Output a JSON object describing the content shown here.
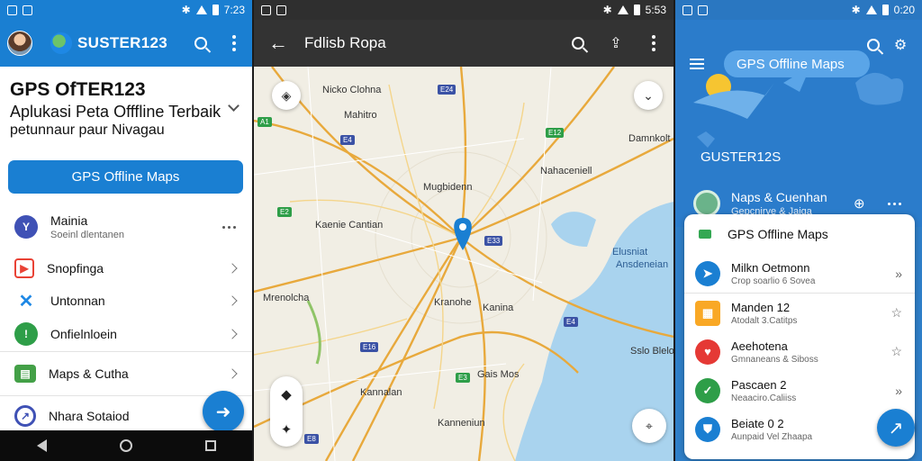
{
  "phone1": {
    "status": {
      "time": "7:23"
    },
    "appbar": {
      "title": "SUSTER123"
    },
    "heading": {
      "title": "GPS OfTER123",
      "subtitle": "Aplukasi Peta Offfline Terbaik",
      "subtitle2": "petunnaur paur Nivagau"
    },
    "primary_button": "GPS Offline Maps",
    "items": [
      {
        "title": "Mainia",
        "subtitle": "Soeinl dlentanen",
        "icon": "pin-icon",
        "color": "#3f51b5"
      },
      {
        "title": "Snopfinga",
        "subtitle": "",
        "icon": "maps-logo-icon",
        "color": "#e94235"
      },
      {
        "title": "Untonnan",
        "subtitle": "",
        "icon": "cross-arrows-icon",
        "color": "#1e88e5"
      },
      {
        "title": "Onfielnloein",
        "subtitle": "",
        "icon": "location-icon",
        "color": "#2e9e48"
      },
      {
        "title": "Maps & Cutha",
        "subtitle": "",
        "icon": "map-card-icon",
        "color": "#43a047"
      },
      {
        "title": "Nhara Sotaiod",
        "subtitle": "",
        "icon": "compass-icon",
        "color": "#3f51b5"
      }
    ],
    "fab_icon": "navigate-icon"
  },
  "phone2": {
    "status": {
      "time": "5:53"
    },
    "appbar": {
      "title": "Fdlisb Ropa"
    },
    "labels": [
      "Nicko Clohna",
      "Mahitro",
      "Damnkolt",
      "Mugbidenn",
      "Kaenie Cantian",
      "Mrenolcha",
      "Kranohe",
      "Kanina",
      "Kannalan",
      "Kanneniun",
      "Gais Mos",
      "Nahaceniell",
      "Sslo Blelo",
      "Elusniat",
      "Ansdeneian"
    ]
  },
  "phone3": {
    "status": {
      "time": "0:20"
    },
    "pill_title": "GPS Offline Maps",
    "hero_title": "GUSTER12S",
    "hero_card": {
      "title": "Naps & Cuenhan",
      "subtitle": "Gepcnirve & Jaiga"
    },
    "sheet_title": "GPS Offline Maps",
    "items": [
      {
        "title": "Milkn Oetmonn",
        "subtitle": "Crop soarlio 6 Sovea",
        "color": "#1a7fd2",
        "trail": "»"
      },
      {
        "title": "Manden 12",
        "subtitle": "Atodalt 3.Catitps",
        "color": "#f9a825",
        "trail": "☆"
      },
      {
        "title": "Aeehotena",
        "subtitle": "Gmnaneans & Siboss",
        "color": "#e53935",
        "trail": "☆"
      },
      {
        "title": "Pascaen 2",
        "subtitle": "Neaaciro.Caliiss",
        "color": "#2e9e48",
        "trail": "»"
      },
      {
        "title": "Beiate 0 2",
        "subtitle": "Aunpaid Vel Zhaapa",
        "color": "#1a7fd2",
        "trail": ""
      }
    ]
  }
}
